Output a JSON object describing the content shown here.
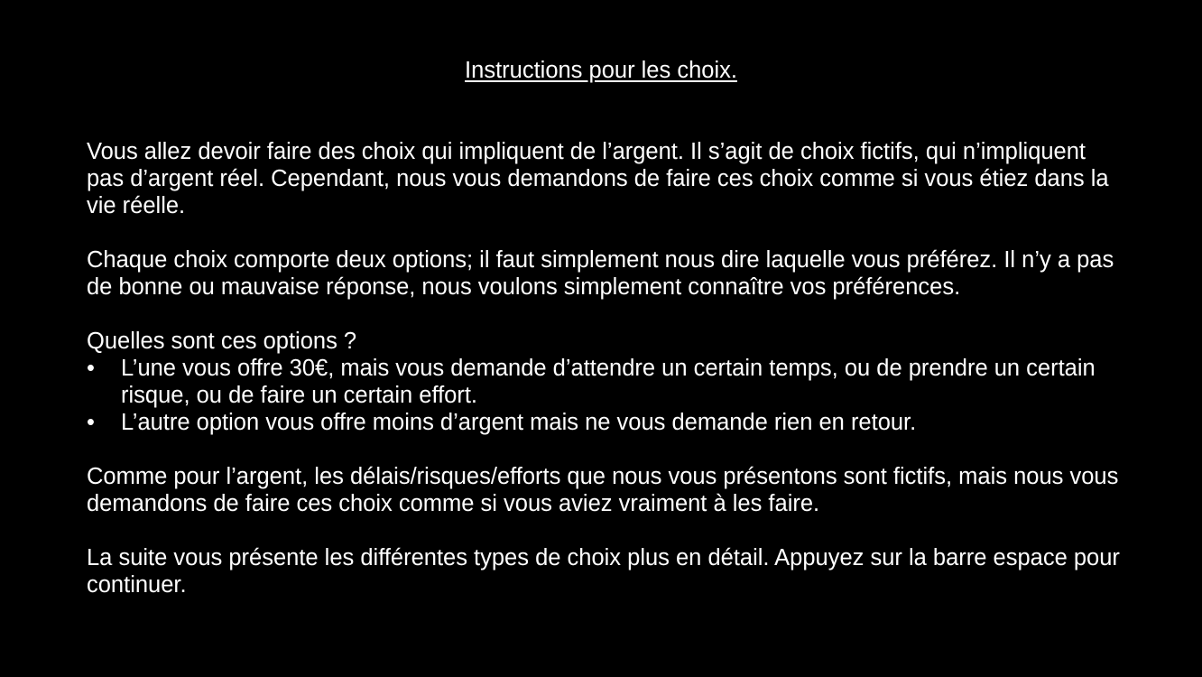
{
  "title": "Instructions pour les choix.",
  "paragraphs": {
    "p1": "Vous allez devoir faire des choix qui impliquent de l’argent. Il s’agit de choix fictifs, qui n’impliquent pas d’argent réel. Cependant, nous vous demandons de faire ces choix comme si vous étiez dans la vie réelle.",
    "p2": "Chaque choix comporte deux options; il faut simplement nous dire laquelle vous préférez. Il n’y a pas de bonne ou mauvaise réponse, nous voulons simplement connaître vos préférences.",
    "question": "Quelles sont ces options ?",
    "p3": "Comme pour l’argent, les délais/risques/efforts que nous vous présentons sont fictifs, mais nous vous demandons de faire ces choix comme si vous aviez vraiment à les faire.",
    "p4": "La suite vous présente les différentes types de choix plus en détail. Appuyez sur la barre espace pour continuer."
  },
  "options": [
    {
      "bullet": "•",
      "text": "L’une vous offre 30€, mais vous demande d’attendre un certain temps, ou de prendre un certain risque, ou de faire un certain effort."
    },
    {
      "bullet": "•",
      "text": "L’autre option vous offre moins d’argent mais ne vous demande rien en retour."
    }
  ],
  "colors": {
    "background": "#000000",
    "text": "#ffffff"
  }
}
